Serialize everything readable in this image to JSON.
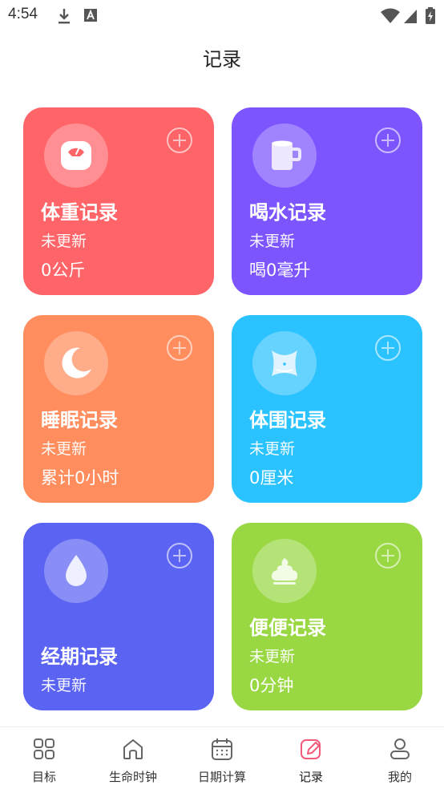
{
  "status_bar": {
    "time": "4:54"
  },
  "page": {
    "title": "记录"
  },
  "cards": [
    {
      "title": "体重记录",
      "status": "未更新",
      "value": "0公斤",
      "color": "#FF6469",
      "icon": "scale-icon"
    },
    {
      "title": "喝水记录",
      "status": "未更新",
      "value": "喝0毫升",
      "color": "#7C55FF",
      "icon": "cup-icon"
    },
    {
      "title": "睡眠记录",
      "status": "未更新",
      "value": "累计0小时",
      "color": "#FF8D5E",
      "icon": "moon-icon"
    },
    {
      "title": "体围记录",
      "status": "未更新",
      "value": "0厘米",
      "color": "#2BC3FF",
      "icon": "waist-icon"
    },
    {
      "title": "经期记录",
      "status": "未更新",
      "color": "#5A63F2",
      "icon": "drop-icon"
    },
    {
      "title": "便便记录",
      "status": "未更新",
      "value": "0分钟",
      "color": "#99D843",
      "icon": "poop-icon"
    }
  ],
  "tabbar": {
    "items": [
      {
        "label": "目标",
        "icon": "grid-icon"
      },
      {
        "label": "生命时钟",
        "icon": "home-icon"
      },
      {
        "label": "日期计算",
        "icon": "calendar-icon"
      },
      {
        "label": "记录",
        "icon": "edit-icon",
        "active": true,
        "active_color": "#F25A7A"
      },
      {
        "label": "我的",
        "icon": "person-icon"
      }
    ]
  }
}
